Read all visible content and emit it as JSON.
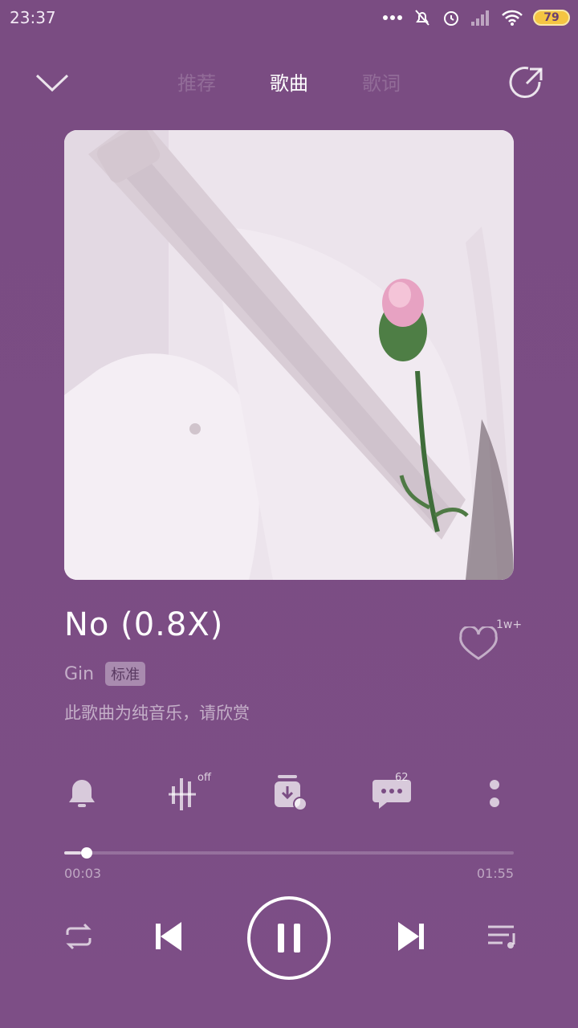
{
  "status_bar": {
    "time": "23:37",
    "battery": "79",
    "icons": [
      "more-dots-icon",
      "mute-bell-icon",
      "alarm-icon",
      "signal-icon",
      "wifi-icon",
      "battery-icon"
    ]
  },
  "header": {
    "tabs": [
      {
        "label": "推荐"
      },
      {
        "label": "歌曲"
      },
      {
        "label": "歌词"
      }
    ],
    "active_tab": 1
  },
  "song": {
    "title": "No (0.8X)",
    "artist": "Gin",
    "quality": "标准",
    "note": "此歌曲为纯音乐，请欣赏",
    "likes": "1w+"
  },
  "actions": {
    "effects_badge": "off",
    "comments_badge": "62"
  },
  "playback": {
    "current_time": "00:03",
    "total_time": "01:55",
    "progress": 0.037
  },
  "colors": {
    "background": "#7b4d84",
    "accent": "#ffffff",
    "battery": "#f5c542"
  }
}
